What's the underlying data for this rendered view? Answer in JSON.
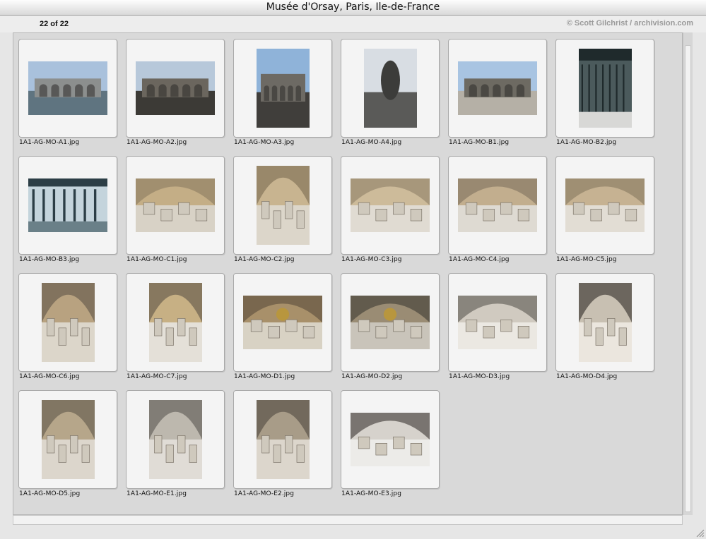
{
  "window": {
    "title": "Musée d'Orsay, Paris, Ile-de-France"
  },
  "header": {
    "count": "22 of 22",
    "credit": "© Scott Gilchrist / archivision.com"
  },
  "thumbnails": [
    {
      "file": "1A1-AG-MO-A1.jpg",
      "orientation": "landscape",
      "scene": "exterior-river",
      "colors": [
        "#a9c1dc",
        "#8c8f8e",
        "#5f7480"
      ]
    },
    {
      "file": "1A1-AG-MO-A2.jpg",
      "orientation": "landscape",
      "scene": "facade-arches",
      "colors": [
        "#b7c8da",
        "#6b665e",
        "#3c3a36"
      ]
    },
    {
      "file": "1A1-AG-MO-A3.jpg",
      "orientation": "portrait",
      "scene": "facade-dome",
      "colors": [
        "#8fb3d9",
        "#6d6a64",
        "#403e3b"
      ]
    },
    {
      "file": "1A1-AG-MO-A4.jpg",
      "orientation": "portrait",
      "scene": "sculpture",
      "colors": [
        "#d8dde3",
        "#5a5a58",
        "#2e2f31"
      ]
    },
    {
      "file": "1A1-AG-MO-B1.jpg",
      "orientation": "landscape",
      "scene": "facade-plaza",
      "colors": [
        "#a8c4e2",
        "#6d6a62",
        "#b5b0a6"
      ]
    },
    {
      "file": "1A1-AG-MO-B2.jpg",
      "orientation": "portrait",
      "scene": "glass-canopy",
      "colors": [
        "#4b5a5c",
        "#1f2a2c",
        "#d8d8d6"
      ]
    },
    {
      "file": "1A1-AG-MO-B3.jpg",
      "orientation": "landscape",
      "scene": "glass-canopy-front",
      "colors": [
        "#c4d4dc",
        "#2c3e46",
        "#6a8088"
      ]
    },
    {
      "file": "1A1-AG-MO-C1.jpg",
      "orientation": "landscape",
      "scene": "nave-vault",
      "colors": [
        "#c4ae86",
        "#8a7a60",
        "#d8d2c6"
      ]
    },
    {
      "file": "1A1-AG-MO-C2.jpg",
      "orientation": "portrait",
      "scene": "nave-vault",
      "colors": [
        "#c8b490",
        "#7a6a52",
        "#dcd6ca"
      ]
    },
    {
      "file": "1A1-AG-MO-C3.jpg",
      "orientation": "landscape",
      "scene": "interior-hall",
      "colors": [
        "#cdbb9a",
        "#8e7f68",
        "#e0dbd2"
      ]
    },
    {
      "file": "1A1-AG-MO-C4.jpg",
      "orientation": "landscape",
      "scene": "interior-hall",
      "colors": [
        "#c2ae8e",
        "#7d705e",
        "#dedad2"
      ]
    },
    {
      "file": "1A1-AG-MO-C5.jpg",
      "orientation": "landscape",
      "scene": "interior-hall",
      "colors": [
        "#c6b292",
        "#86785f",
        "#e2ddd4"
      ]
    },
    {
      "file": "1A1-AG-MO-C6.jpg",
      "orientation": "portrait",
      "scene": "interior-stairs",
      "colors": [
        "#b8a280",
        "#5e5447",
        "#dcd6ca"
      ]
    },
    {
      "file": "1A1-AG-MO-C7.jpg",
      "orientation": "portrait",
      "scene": "interior-arches",
      "colors": [
        "#c7b084",
        "#5c5346",
        "#e4e0d8"
      ]
    },
    {
      "file": "1A1-AG-MO-D1.jpg",
      "orientation": "landscape",
      "scene": "interior-clock",
      "colors": [
        "#a8906a",
        "#5a4d3c",
        "#d8d2c4"
      ]
    },
    {
      "file": "1A1-AG-MO-D2.jpg",
      "orientation": "landscape",
      "scene": "interior-clock-window",
      "colors": [
        "#9a8c74",
        "#3e3a34",
        "#c9c4ba"
      ]
    },
    {
      "file": "1A1-AG-MO-D3.jpg",
      "orientation": "landscape",
      "scene": "interior-bridge",
      "colors": [
        "#d0cac0",
        "#5a5650",
        "#ebe8e2"
      ]
    },
    {
      "file": "1A1-AG-MO-D4.jpg",
      "orientation": "portrait",
      "scene": "interior-stairs",
      "colors": [
        "#c8c0b2",
        "#2e2a26",
        "#ebe6de"
      ]
    },
    {
      "file": "1A1-AG-MO-D5.jpg",
      "orientation": "portrait",
      "scene": "interior-tower",
      "colors": [
        "#b6a68a",
        "#5e564a",
        "#dcd6cc"
      ]
    },
    {
      "file": "1A1-AG-MO-E1.jpg",
      "orientation": "portrait",
      "scene": "interior-tower",
      "colors": [
        "#bdb8ae",
        "#585550",
        "#e0dcd6"
      ]
    },
    {
      "file": "1A1-AG-MO-E2.jpg",
      "orientation": "portrait",
      "scene": "interior-tower",
      "colors": [
        "#a89c88",
        "#4e4840",
        "#dcd6cc"
      ]
    },
    {
      "file": "1A1-AG-MO-E3.jpg",
      "orientation": "landscape",
      "scene": "interior-gallery",
      "colors": [
        "#d6d2cc",
        "#3a3632",
        "#ecebe8"
      ]
    }
  ]
}
